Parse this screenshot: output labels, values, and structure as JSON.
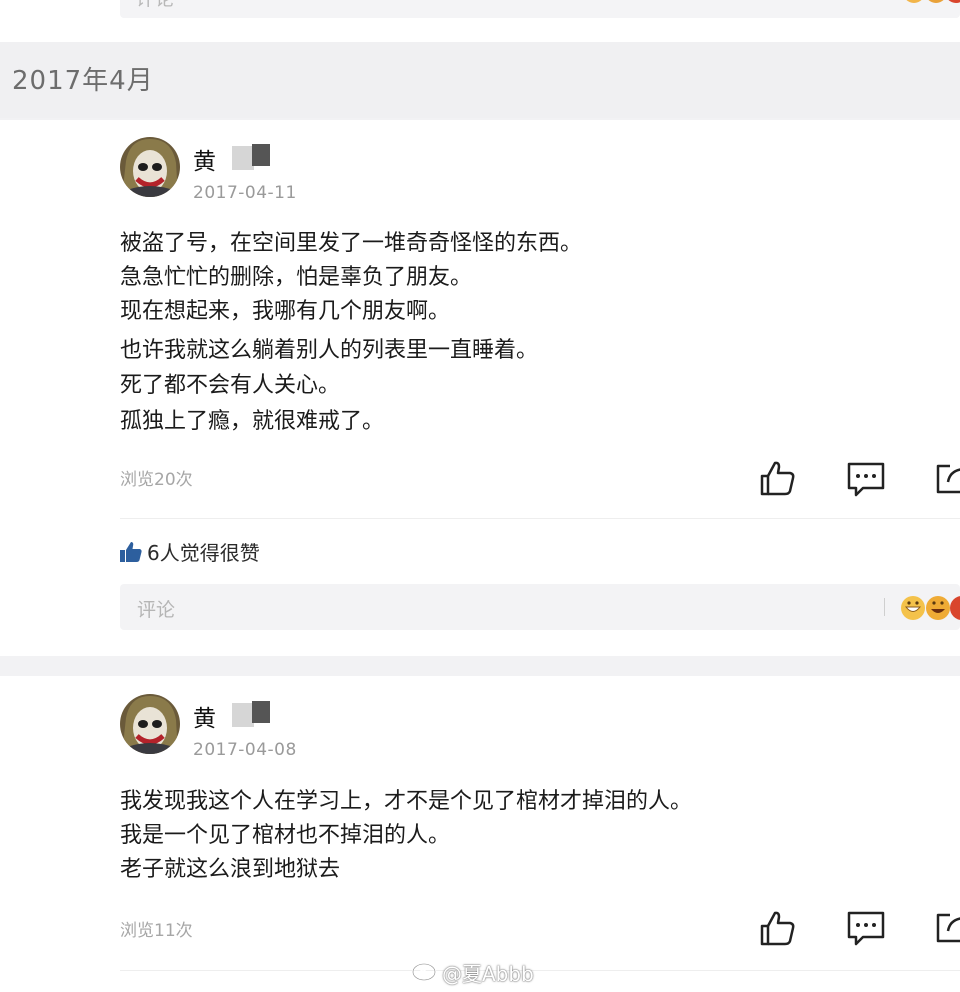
{
  "month_header": "2017年4月",
  "comment_placeholder": "评论",
  "posts": [
    {
      "author": "黄",
      "date": "2017-04-11",
      "lines": [
        "被盗了号，在空间里发了一堆奇奇怪怪的东西。",
        "急急忙忙的删除，怕是辜负了朋友。",
        "现在想起来，我哪有几个朋友啊。",
        "也许我就这么躺着别人的列表里一直睡着。",
        "死了都不会有人关心。",
        "孤独上了瘾，就很难戒了。"
      ],
      "views": "浏览20次",
      "likes": "6人觉得很赞"
    },
    {
      "author": "黄",
      "date": "2017-04-08",
      "lines": [
        "我发现我这个人在学习上，才不是个见了棺材才掉泪的人。",
        "我是一个见了棺材也不掉泪的人。",
        "老子就这么浪到地狱去"
      ],
      "views": "浏览11次"
    }
  ],
  "icons": {
    "like": "thumbs-up-icon",
    "comment": "comment-bubble-icon",
    "share": "share-icon"
  },
  "watermark": "@夏Abbb",
  "colors": {
    "background": "#f2f2f4",
    "card": "#ffffff",
    "secondary_text": "#9a9a9a",
    "like_blue": "#2d5f9e"
  }
}
